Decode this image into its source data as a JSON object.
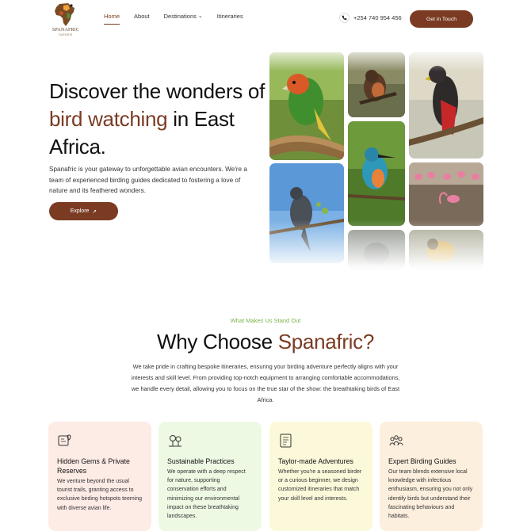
{
  "brand": {
    "name": "SPANAFRIC",
    "tagline": "SAFARIS"
  },
  "nav": {
    "links": [
      {
        "label": "Home",
        "active": true
      },
      {
        "label": "About",
        "active": false
      },
      {
        "label": "Destinations",
        "active": false,
        "dropdown": true
      },
      {
        "label": "Itineraries",
        "active": false
      }
    ],
    "phone": "+254 740 954 456",
    "cta": "Get in Touch"
  },
  "hero": {
    "title_part1": "Discover the wonders of ",
    "title_accent": "bird watching",
    "title_part2": " in East Africa.",
    "description": "Spanafric is your gateway to unforgettable avian encounters. We're a team of experienced birding guides dedicated to fostering a love of nature and its feathered wonders.",
    "button": "Explore"
  },
  "why": {
    "eyebrow": "What Makes Us Stand Out",
    "title_part1": "Why Choose ",
    "title_accent": "Spanafric?",
    "description": "We take pride in crafting bespoke itineraries, ensuring your birding adventure perfectly aligns with your interests and skill level. From providing top-notch equipment to arranging comfortable accommodations, we handle every detail, allowing you to focus on the true star of the show: the breathtaking birds of East Africa.",
    "cards": [
      {
        "title": "Hidden Gems & Private Reserves",
        "text": "We venture beyond the usual tourist trails, granting access to exclusive birding hotspots teeming with diverse avian life.",
        "icon": "map-pin-icon",
        "bg": "#fdebe6"
      },
      {
        "title": "Sustainable Practices",
        "text": "We operate with a deep respect for nature, supporting conservation efforts and minimizing our environmental impact on these breathtaking landscapes.",
        "icon": "tree-icon",
        "bg": "#eef9e4"
      },
      {
        "title": "Taylor-made Adventures",
        "text": "Whether you're a seasoned birder or a curious beginner, we design customized itineraries that match your skill level and interests.",
        "icon": "itinerary-icon",
        "bg": "#fbf9da"
      },
      {
        "title": "Expert Birding Guides",
        "text": "Our team blends extensive local knowledge with infectious enthusiasm, ensuring you not only identify birds but understand their fascinating behaviours and habitats.",
        "icon": "team-icon",
        "bg": "#fdefde"
      }
    ]
  },
  "colors": {
    "accent": "#7a3b22",
    "eyebrow": "#7ab34a"
  }
}
